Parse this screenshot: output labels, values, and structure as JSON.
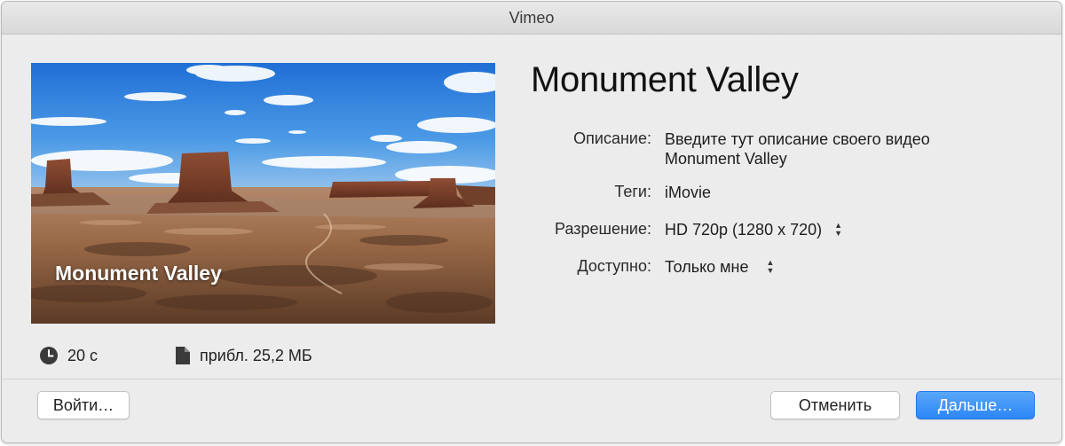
{
  "window": {
    "title": "Vimeo"
  },
  "preview": {
    "caption": "Monument Valley"
  },
  "info": {
    "duration": "20 с",
    "size": "прибл. 25,2 МБ",
    "icons": {
      "duration": "clock-icon",
      "size": "document-icon"
    }
  },
  "details": {
    "title": "Monument Valley",
    "description_label": "Описание:",
    "description_lines": [
      "Введите тут описание своего видео",
      "Monument Valley"
    ],
    "tags_label": "Теги:",
    "tags_value": "iMovie",
    "resolution_label": "Разрешение:",
    "resolution_value": "HD 720p (1280 x 720)",
    "access_label": "Доступно:",
    "access_value": "Только мне",
    "stepper_up": "▲",
    "stepper_down": "▼"
  },
  "buttons": {
    "login": "Войти…",
    "cancel": "Отменить",
    "next": "Дальше…"
  },
  "colors": {
    "accent": "#2c86f6",
    "window_bg": "#ececec"
  }
}
